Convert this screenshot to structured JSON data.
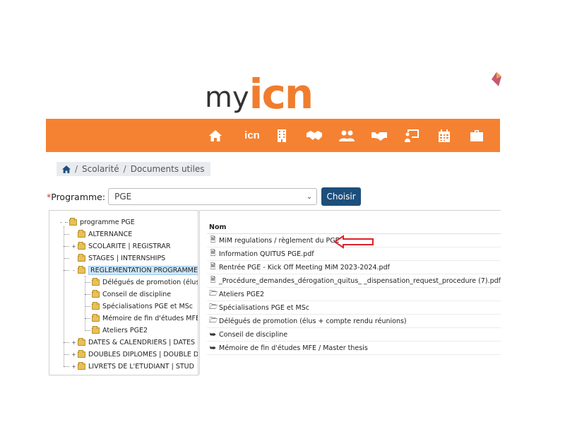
{
  "logo": {
    "my": "my",
    "icn": "icn"
  },
  "colors": {
    "nav_bg": "#f58232",
    "logo_orange": "#f07d2e",
    "button_blue": "#1d4f7c",
    "arrow_red": "#e0212b"
  },
  "nav": {
    "icons": [
      "home-icon",
      "icn",
      "building-icon",
      "handshake-icon",
      "users-icon",
      "handshake-group-icon",
      "presentation-icon",
      "calendar-icon",
      "briefcase-icon"
    ],
    "text_item": "icn"
  },
  "breadcrumb": {
    "home_icon": "home-icon",
    "items": [
      "Scolarité",
      "Documents utiles"
    ]
  },
  "programme": {
    "label": "Programme:",
    "required": "*",
    "selected": "PGE",
    "button": "Choisir"
  },
  "tree": {
    "root": "programme PGE",
    "items": [
      {
        "label": "ALTERNANCE",
        "level": 1,
        "expander": ""
      },
      {
        "label": "SCOLARITE | REGISTRAR",
        "level": 1,
        "expander": "+"
      },
      {
        "label": "STAGES | INTERNSHIPS",
        "level": 1,
        "expander": ""
      },
      {
        "label": "REGLEMENTATION PROGRAMME",
        "level": 1,
        "expander": "-",
        "selected": true
      },
      {
        "label": "Délégués de promotion (élus",
        "level": 2,
        "expander": ""
      },
      {
        "label": "Conseil de discipline",
        "level": 2,
        "expander": ""
      },
      {
        "label": "Spécialisations PGE et MSc",
        "level": 2,
        "expander": ""
      },
      {
        "label": "Mémoire de fin d'études MFE",
        "level": 2,
        "expander": ""
      },
      {
        "label": "Ateliers PGE2",
        "level": 2,
        "expander": ""
      },
      {
        "label": "DATES & CALENDRIERS | DATES",
        "level": 1,
        "expander": "+"
      },
      {
        "label": "DOUBLES DIPLOMES | DOUBLE D",
        "level": 1,
        "expander": "+"
      },
      {
        "label": "LIVRETS DE L'ETUDIANT | STUD",
        "level": 1,
        "expander": "+"
      }
    ]
  },
  "files": {
    "header": "Nom",
    "rows": [
      {
        "icon": "🗎",
        "name": "MiM regulations / règlement du PGE"
      },
      {
        "icon": "🗎",
        "name": "Information QUITUS PGE.pdf"
      },
      {
        "icon": "🗎",
        "name": "Rentrée PGE - Kick Off Meeting MiM 2023-2024.pdf"
      },
      {
        "icon": "🗎",
        "name": "_Procédure_demandes_dérogation_quitus_ _dispensation_request_procedure (7).pdf"
      },
      {
        "icon": "🗁",
        "name": "Ateliers PGE2"
      },
      {
        "icon": "🗁",
        "name": "Spécialisations PGE et MSc"
      },
      {
        "icon": "🗁",
        "name": "Délégués de promotion (élus + compte rendu réunions)"
      },
      {
        "icon": "⮩",
        "name": "Conseil de discipline"
      },
      {
        "icon": "⮩",
        "name": "Mémoire de fin d'études MFE / Master thesis"
      }
    ]
  }
}
